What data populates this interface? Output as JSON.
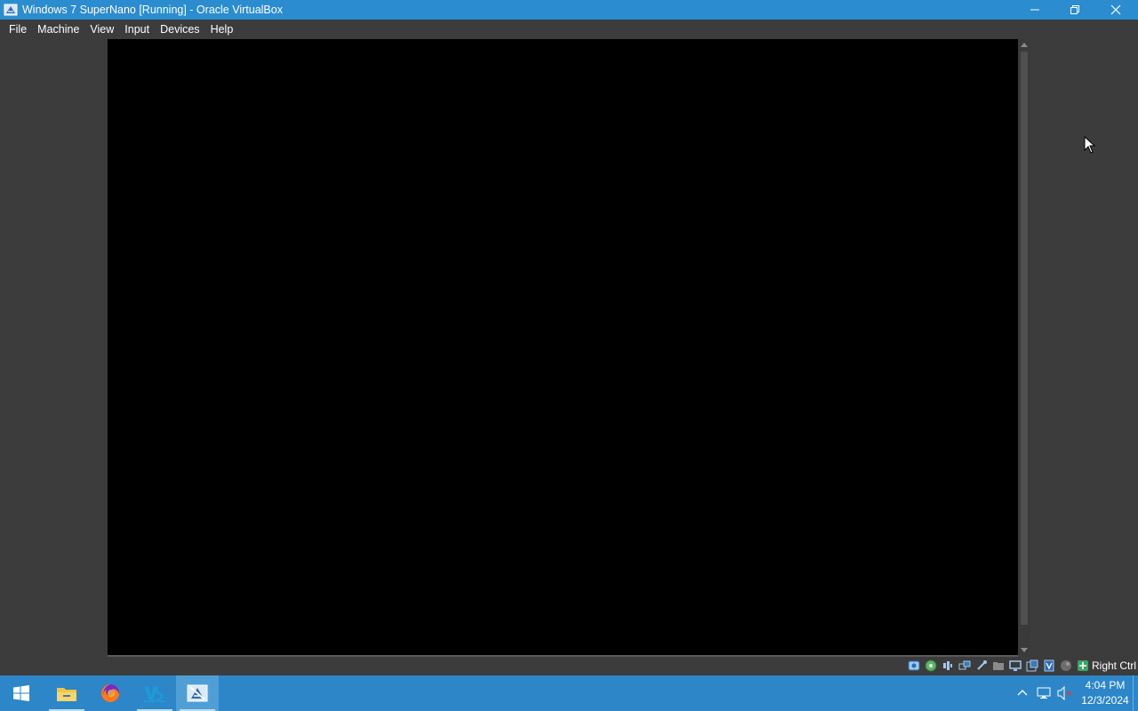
{
  "window": {
    "title": "Windows 7 SuperNano [Running] - Oracle VirtualBox",
    "icon": "virtualbox-vm-icon"
  },
  "window_controls": [
    "minimize",
    "restore",
    "close"
  ],
  "menu": {
    "items": [
      {
        "label": "File"
      },
      {
        "label": "Machine"
      },
      {
        "label": "View"
      },
      {
        "label": "Input"
      },
      {
        "label": "Devices"
      },
      {
        "label": "Help"
      }
    ]
  },
  "status_bar": {
    "icons": [
      "hard-disk-icon",
      "optical-drive-icon",
      "audio-icon",
      "network-icon",
      "usb-icon",
      "shared-folders-icon",
      "display-icon",
      "video-capture-icon",
      "virtualization-icon",
      "mouse-integration-icon",
      "keyboard-icon"
    ],
    "host_key": "Right Ctrl"
  },
  "taskbar": {
    "apps": [
      {
        "name": "start-button"
      },
      {
        "name": "file-explorer"
      },
      {
        "name": "firefox"
      },
      {
        "name": "vs-app"
      },
      {
        "name": "virtualbox"
      }
    ],
    "clock": {
      "time": "4:04 PM",
      "date": "12/3/2024"
    }
  },
  "colors": {
    "titlebar": "#2b8ccf",
    "taskbar": "#2c86c8",
    "background": "#3c3c3c",
    "vm_screen": "#000000"
  }
}
